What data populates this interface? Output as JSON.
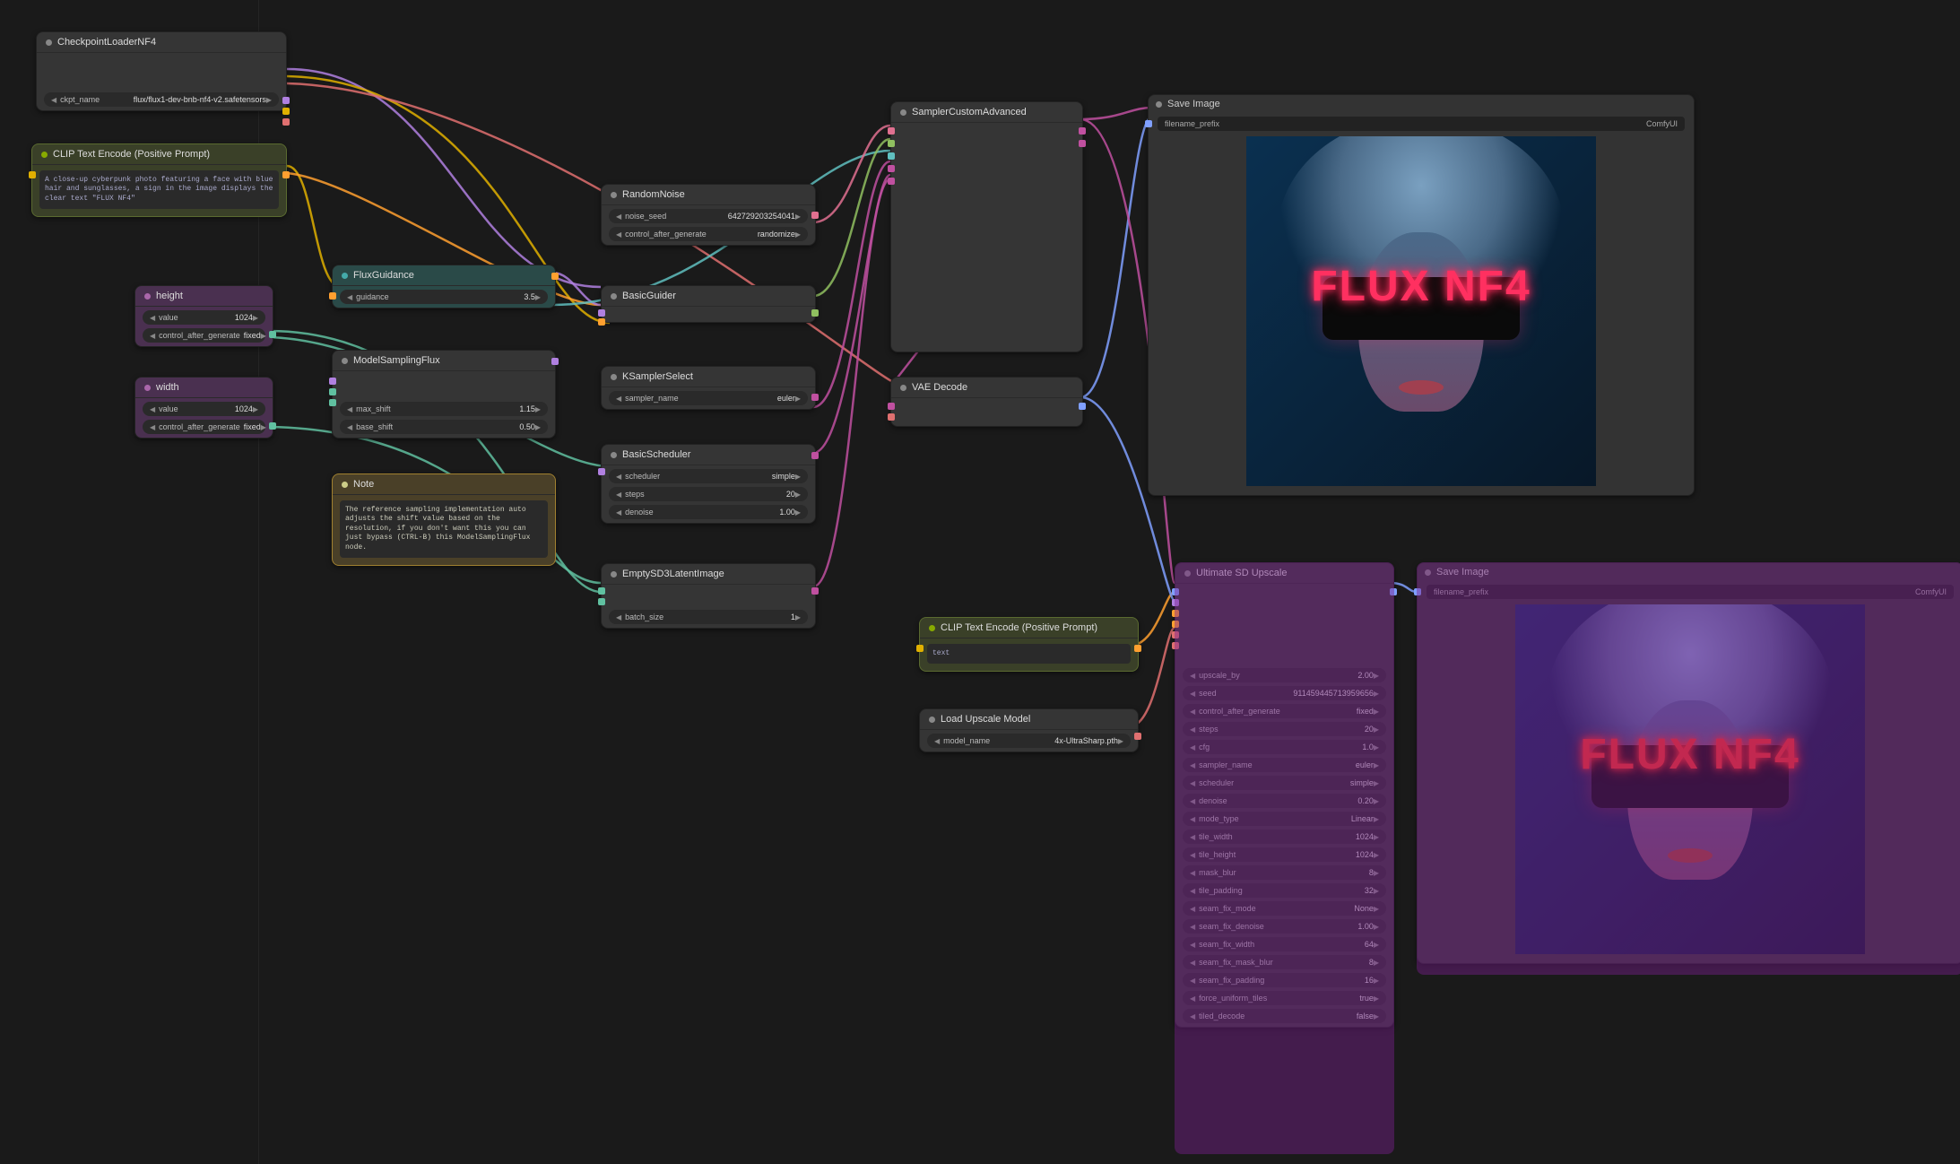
{
  "nodes": {
    "checkpoint": {
      "title": "CheckpointLoaderNF4",
      "ckpt_label": "ckpt_name",
      "ckpt_value": "flux/flux1-dev-bnb-nf4-v2.safetensors"
    },
    "clipPos": {
      "title": "CLIP Text Encode (Positive Prompt)",
      "text": "A close-up cyberpunk photo featuring a face with blue hair and sunglasses, a sign in the image displays the clear text \"FLUX NF4\""
    },
    "clipPos2": {
      "title": "CLIP Text Encode (Positive Prompt)",
      "text": "text"
    },
    "height": {
      "title": "height",
      "value_label": "value",
      "value": "1024",
      "cag_label": "control_after_generate",
      "cag_value": "fixed"
    },
    "width": {
      "title": "width",
      "value_label": "value",
      "value": "1024",
      "cag_label": "control_after_generate",
      "cag_value": "fixed"
    },
    "fluxGuidance": {
      "title": "FluxGuidance",
      "guidance_label": "guidance",
      "guidance_value": "3.5"
    },
    "modelSampling": {
      "title": "ModelSamplingFlux",
      "max_label": "max_shift",
      "max_value": "1.15",
      "base_label": "base_shift",
      "base_value": "0.50"
    },
    "note": {
      "title": "Note",
      "text": "The reference sampling implementation auto adjusts the shift value based on the resolution, if you don't want this you can just bypass (CTRL-B) this ModelSamplingFlux node."
    },
    "randomNoise": {
      "title": "RandomNoise",
      "seed_label": "noise_seed",
      "seed_value": "642729203254041",
      "cag_label": "control_after_generate",
      "cag_value": "randomize"
    },
    "basicGuider": {
      "title": "BasicGuider"
    },
    "ksampler": {
      "title": "KSamplerSelect",
      "sampler_label": "sampler_name",
      "sampler_value": "euler"
    },
    "basicScheduler": {
      "title": "BasicScheduler",
      "sched_label": "scheduler",
      "sched_value": "simple",
      "steps_label": "steps",
      "steps_value": "20",
      "denoise_label": "denoise",
      "denoise_value": "1.00"
    },
    "emptyLatent": {
      "title": "EmptySD3LatentImage",
      "batch_label": "batch_size",
      "batch_value": "1"
    },
    "samplerCustom": {
      "title": "SamplerCustomAdvanced"
    },
    "vaeDecode": {
      "title": "VAE Decode"
    },
    "saveImage": {
      "title": "Save Image",
      "prefix_label": "filename_prefix",
      "prefix_value": "ComfyUI"
    },
    "loadUpscale": {
      "title": "Load Upscale Model",
      "model_label": "model_name",
      "model_value": "4x-UltraSharp.pth"
    },
    "upscaleSD": {
      "title": "Ultimate SD Upscale",
      "rows": [
        {
          "label": "upscale_by",
          "value": "2.00"
        },
        {
          "label": "seed",
          "value": "911459445713959656"
        },
        {
          "label": "control_after_generate",
          "value": "fixed"
        },
        {
          "label": "steps",
          "value": "20"
        },
        {
          "label": "cfg",
          "value": "1.0"
        },
        {
          "label": "sampler_name",
          "value": "euler"
        },
        {
          "label": "scheduler",
          "value": "simple"
        },
        {
          "label": "denoise",
          "value": "0.20"
        },
        {
          "label": "mode_type",
          "value": "Linear"
        },
        {
          "label": "tile_width",
          "value": "1024"
        },
        {
          "label": "tile_height",
          "value": "1024"
        },
        {
          "label": "mask_blur",
          "value": "8"
        },
        {
          "label": "tile_padding",
          "value": "32"
        },
        {
          "label": "seam_fix_mode",
          "value": "None"
        },
        {
          "label": "seam_fix_denoise",
          "value": "1.00"
        },
        {
          "label": "seam_fix_width",
          "value": "64"
        },
        {
          "label": "seam_fix_mask_blur",
          "value": "8"
        },
        {
          "label": "seam_fix_padding",
          "value": "16"
        },
        {
          "label": "force_uniform_tiles",
          "value": "true"
        },
        {
          "label": "tiled_decode",
          "value": "false"
        }
      ]
    },
    "saveImage2": {
      "title": "Save Image",
      "prefix_label": "filename_prefix",
      "prefix_value": "ComfyUI"
    }
  },
  "neon_text": "FLUX NF4"
}
